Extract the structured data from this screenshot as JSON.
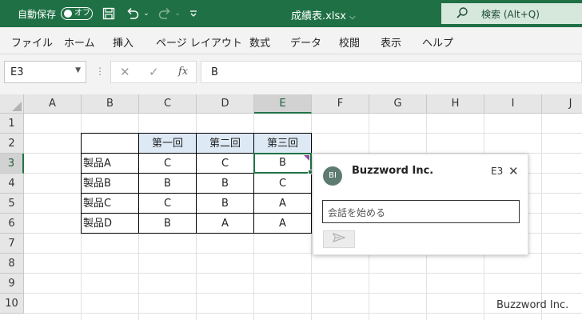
{
  "titlebar": {
    "autosave_label": "自動保存",
    "autosave_toggle": "オフ",
    "filename": "成績表.xlsx",
    "search_label": "検索 (Alt+Q)",
    "bg_color": "#1f7145"
  },
  "menu": {
    "items": [
      "ファイル",
      "ホーム",
      "挿入",
      "ページ レイアウト",
      "数式",
      "データ",
      "校閲",
      "表示",
      "ヘルプ"
    ]
  },
  "formula_bar": {
    "name_box": "E3",
    "fx_label": "fx",
    "value": "B"
  },
  "sheet": {
    "columns": [
      "A",
      "B",
      "C",
      "D",
      "E",
      "F",
      "G",
      "H",
      "I",
      "J"
    ],
    "rows": [
      "1",
      "2",
      "3",
      "4",
      "5",
      "6",
      "7",
      "8",
      "9",
      "10"
    ],
    "selected_cell": "E3",
    "table": {
      "headers": [
        "第一回",
        "第二回",
        "第三回"
      ],
      "rows": [
        {
          "label": "製品A",
          "values": [
            "C",
            "C",
            "B"
          ]
        },
        {
          "label": "製品B",
          "values": [
            "B",
            "B",
            "C"
          ]
        },
        {
          "label": "製品C",
          "values": [
            "C",
            "B",
            "A"
          ]
        },
        {
          "label": "製品D",
          "values": [
            "B",
            "A",
            "A"
          ]
        }
      ]
    }
  },
  "comment": {
    "avatar_initials": "BI",
    "author": "Buzzword Inc.",
    "cell_ref": "E3",
    "placeholder": "会話を始める"
  },
  "watermark": "Buzzword Inc."
}
